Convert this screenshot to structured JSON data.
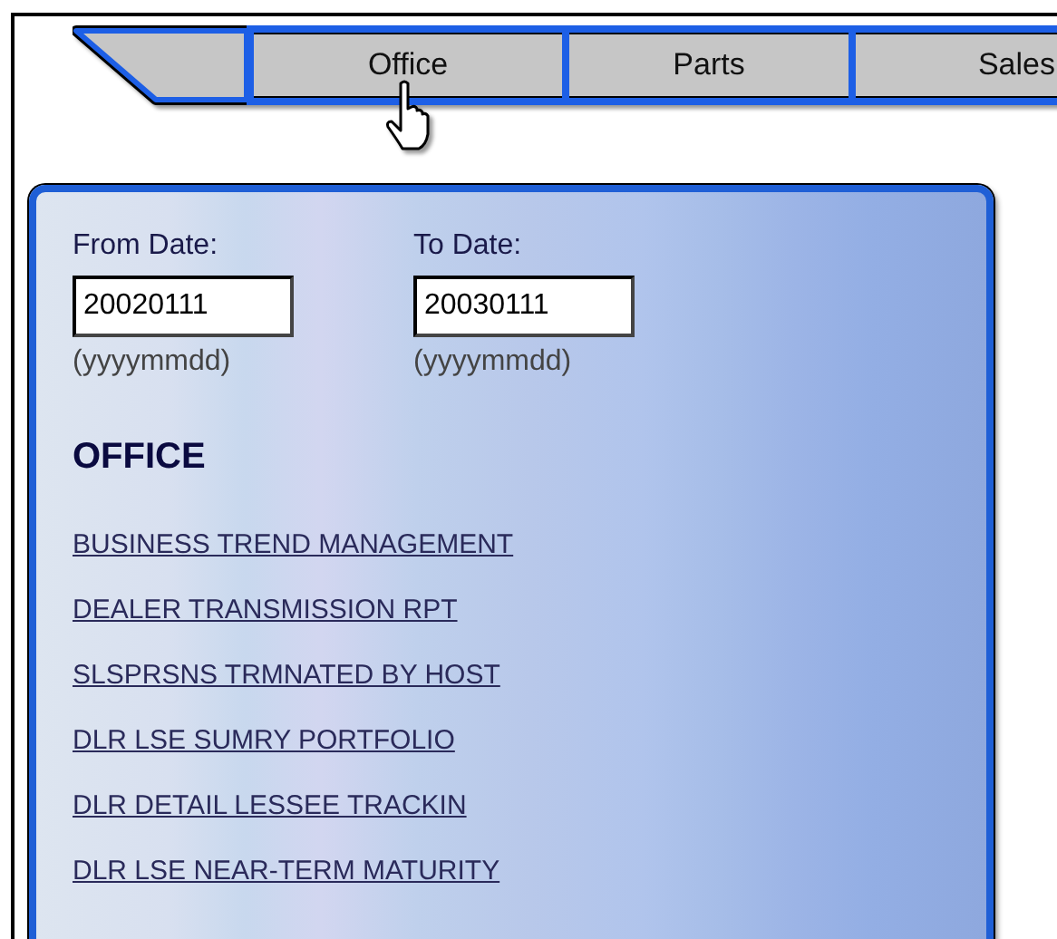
{
  "tabs": [
    {
      "label": "Office"
    },
    {
      "label": "Parts"
    },
    {
      "label": "Sales"
    }
  ],
  "date_fields": [
    {
      "label": "From Date:",
      "value": "20020111",
      "hint": "(yyyymmdd)"
    },
    {
      "label": "To Date:",
      "value": "20030111",
      "hint": "(yyyymmdd)"
    }
  ],
  "section_title": "OFFICE",
  "links": [
    "BUSINESS TREND MANAGEMENT",
    "DEALER TRANSMISSION RPT",
    "SLSPRSNS TRMNATED BY HOST",
    "DLR LSE SUMRY PORTFOLIO",
    "DLR DETAIL LESSEE TRACKIN",
    "DLR LSE NEAR-TERM MATURITY"
  ]
}
